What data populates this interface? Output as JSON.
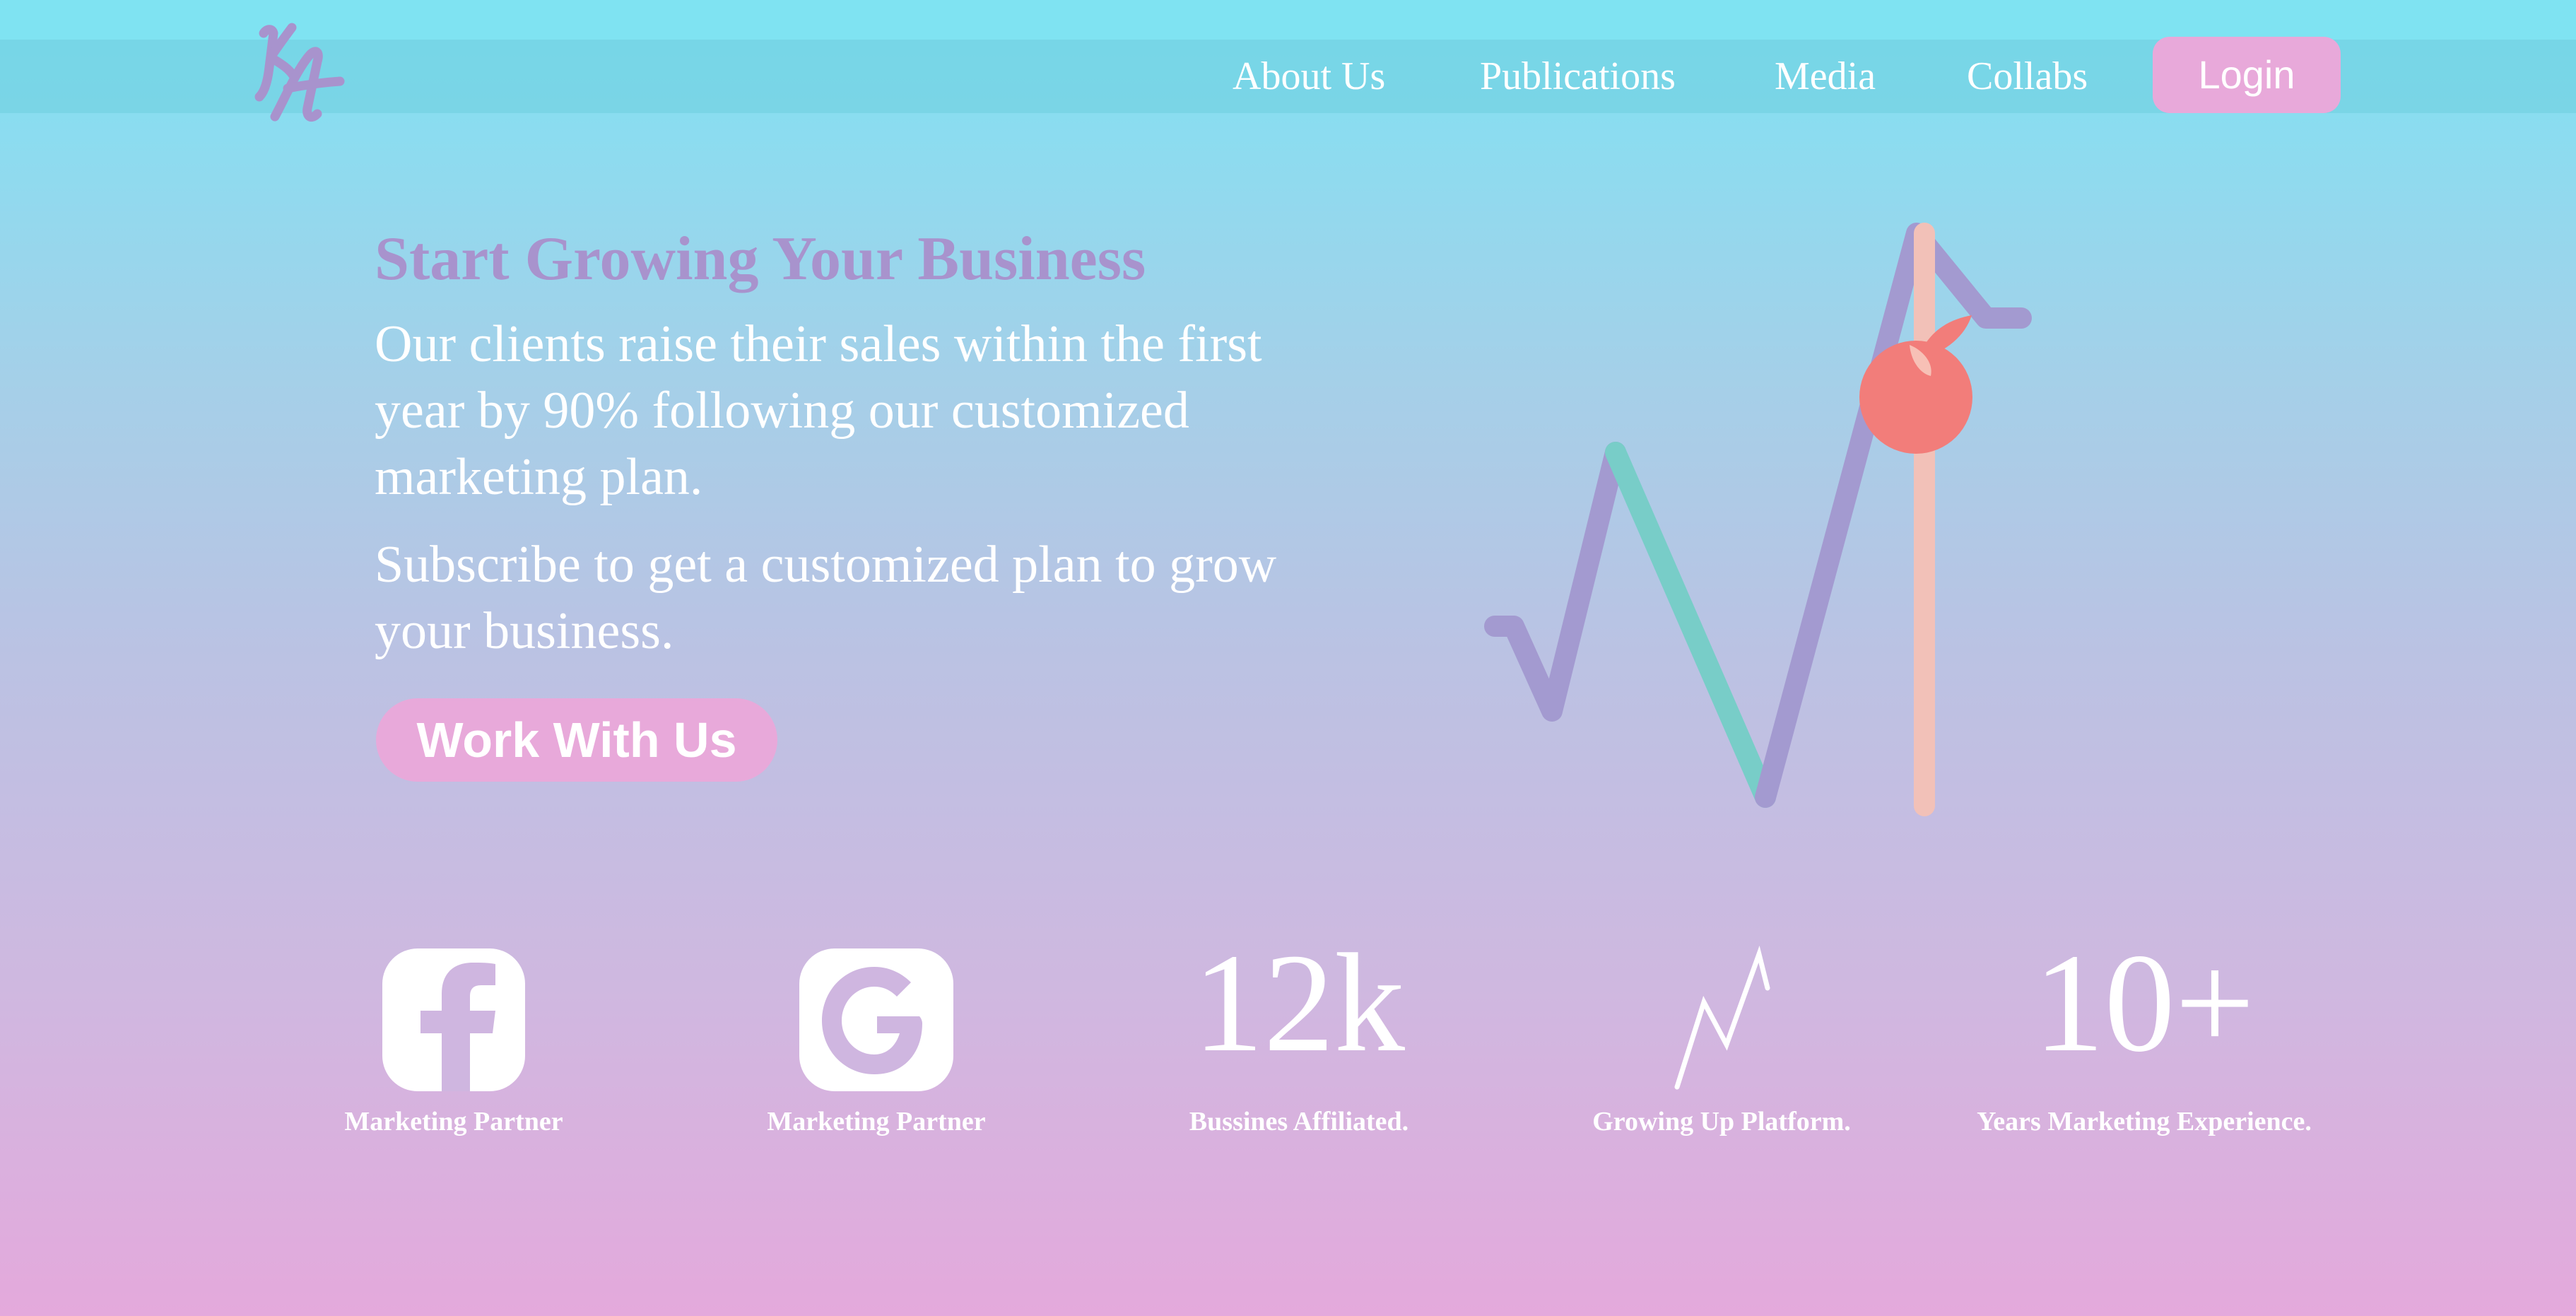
{
  "brand": {
    "logo_text": "KA",
    "logo_color": "#a893cd"
  },
  "nav": {
    "items": [
      {
        "label": "About Us"
      },
      {
        "label": "Publications"
      },
      {
        "label": "Media"
      },
      {
        "label": "Collabs"
      }
    ],
    "login_label": "Login"
  },
  "hero": {
    "title": "Start Growing Your Business",
    "paragraph_1": "Our clients raise their sales within the first year by 90% following our customized marketing plan.",
    "paragraph_2": "Subscribe to get a customized plan to grow your business.",
    "cta_label": "Work With Us",
    "illustration": "growth-chart-with-apple-icon"
  },
  "stats": [
    {
      "icon": "facebook-icon",
      "label": "Marketing Partner"
    },
    {
      "icon": "google-icon",
      "label": "Marketing Partner"
    },
    {
      "number": "12k",
      "label": "Bussines Affiliated."
    },
    {
      "icon": "growth-zigzag-icon",
      "label": "Growing Up Platform."
    },
    {
      "number": "10+",
      "label": "Years Marketing Experience."
    }
  ],
  "colors": {
    "accent_pink": "#e8a9da",
    "accent_purple": "#a893cd",
    "accent_teal": "#78cdc8",
    "accent_coral": "#f27d7a",
    "bar_peach": "#f2c1b8",
    "gradient_top": "#7fe2f3",
    "gradient_bottom": "#e4a9dc"
  }
}
